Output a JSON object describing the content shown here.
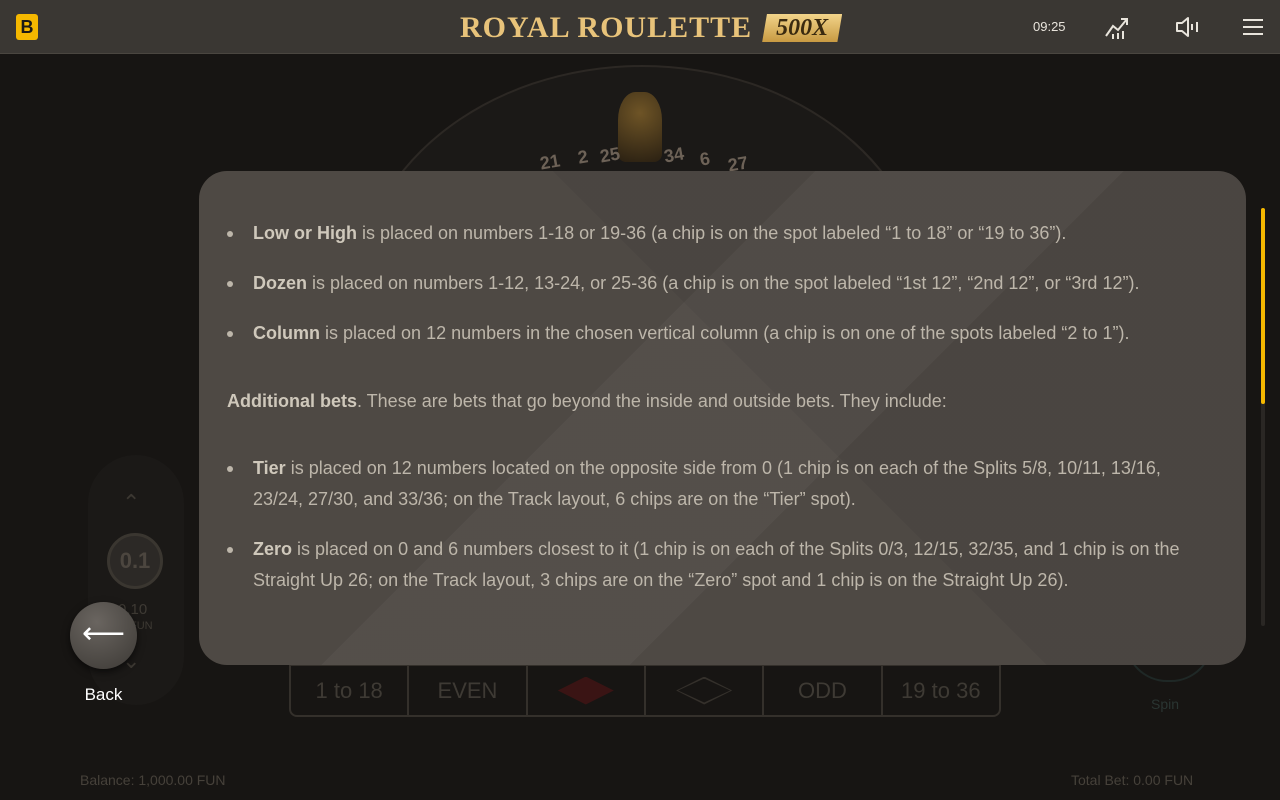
{
  "header": {
    "brand_badge": "B",
    "title": "ROYAL ROULETTE",
    "multiplier": "500X",
    "clock": "09:25",
    "icons": [
      "stats-icon",
      "sound-icon",
      "menu-icon"
    ]
  },
  "background": {
    "wheel_numbers": [
      "21",
      "2",
      "25",
      "34",
      "6",
      "27"
    ],
    "outside_bets": [
      "1 to 18",
      "EVEN",
      "",
      "",
      "ODD",
      "19 to 36"
    ],
    "chip_value": "0.1",
    "chip_bet": "0.10",
    "chip_currency": "FUN",
    "spin_label": "Spin",
    "balance": "Balance: 1,000.00 FUN",
    "total_bet": "Total Bet: 0.00 FUN"
  },
  "help": {
    "outside_items": [
      {
        "term": "Low or High",
        "text": " is placed on numbers 1-18 or 19-36 (a chip is on the spot labeled “1 to 18” or “19 to 36”)."
      },
      {
        "term": "Dozen",
        "text": " is placed on numbers 1-12, 13-24, or 25-36 (a chip is on the spot labeled “1st 12”, “2nd 12”, or “3rd 12”)."
      },
      {
        "term": "Column",
        "text": " is placed on 12 numbers in the chosen vertical column (a chip is on one of the spots labeled “2 to 1”)."
      }
    ],
    "additional_term": "Additional bets",
    "additional_text": ". These are bets that go beyond the inside and outside bets. They include:",
    "additional_items": [
      {
        "term": "Tier",
        "text": " is placed on 12 numbers located on the opposite side from 0 (1 chip is on each of the Splits 5/8, 10/11, 13/16, 23/24, 27/30, and 33/36; on the Track layout, 6 chips are on the “Tier” spot)."
      },
      {
        "term": "Zero",
        "text": " is placed on 0 and 6 numbers closest to it (1 chip is on each of the Splits 0/3, 12/15, 32/35, and 1 chip is on the Straight Up 26; on the Track layout, 3 chips are on the “Zero” spot and 1 chip is on the Straight Up 26)."
      }
    ],
    "scroll_position": 0.0
  },
  "back": {
    "icon": "arrow-left-icon",
    "label": "Back"
  },
  "colors": {
    "accent": "#f5b800",
    "title_gold": "#e8c37a",
    "panel": "#4e4944"
  }
}
